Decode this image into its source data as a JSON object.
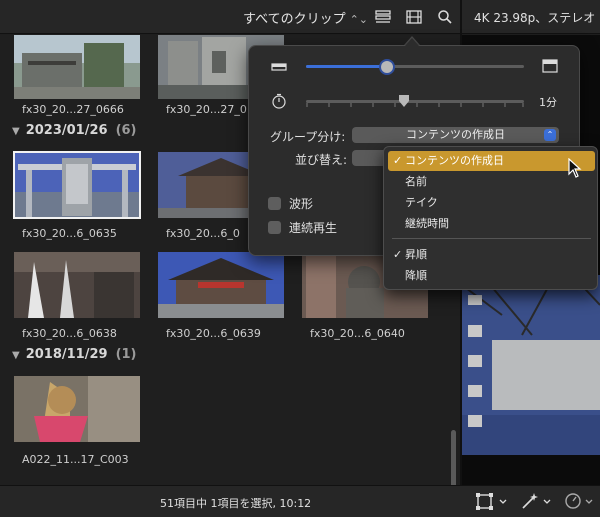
{
  "toolbar": {
    "filter_label": "すべてのクリップ",
    "viewer_title": "4K 23.98p、ステレオ"
  },
  "browser": {
    "groups": [
      {
        "date": "2023/01/26",
        "count": "(6)",
        "clips": [
          "fx30_20...6_0635",
          "fx30_20...6_0",
          "fx30_20...6_0638",
          "fx30_20...6_0639",
          "fx30_20...6_0640"
        ]
      },
      {
        "date": "2018/11/29",
        "count": "(1)",
        "clips": [
          "A022_11...17_C003"
        ]
      }
    ],
    "prev_clips": [
      "fx30_20...27_0666",
      "fx30_20...27_0"
    ]
  },
  "popover": {
    "duration_value": "1分",
    "group_by_label": "グループ分け:",
    "group_by_value": "コンテンツの作成日",
    "sort_label": "並び替え:",
    "waveform_label": "波形",
    "continuous_label": "連続再生"
  },
  "sort_menu": {
    "items": [
      {
        "label": "コンテンツの作成日",
        "checked": true,
        "highlighted": true
      },
      {
        "label": "名前",
        "checked": false
      },
      {
        "label": "テイク",
        "checked": false
      },
      {
        "label": "継続時間",
        "checked": false
      }
    ],
    "order_items": [
      {
        "label": "昇順",
        "checked": true
      },
      {
        "label": "降順",
        "checked": false
      }
    ],
    "checkmark": "✓"
  },
  "status_bar": {
    "selection_text": "51項目中 1項目を選択, 10:12"
  },
  "colors": {
    "accent_blue": "#3b6fd9",
    "menu_highlight": "#c9982e"
  }
}
